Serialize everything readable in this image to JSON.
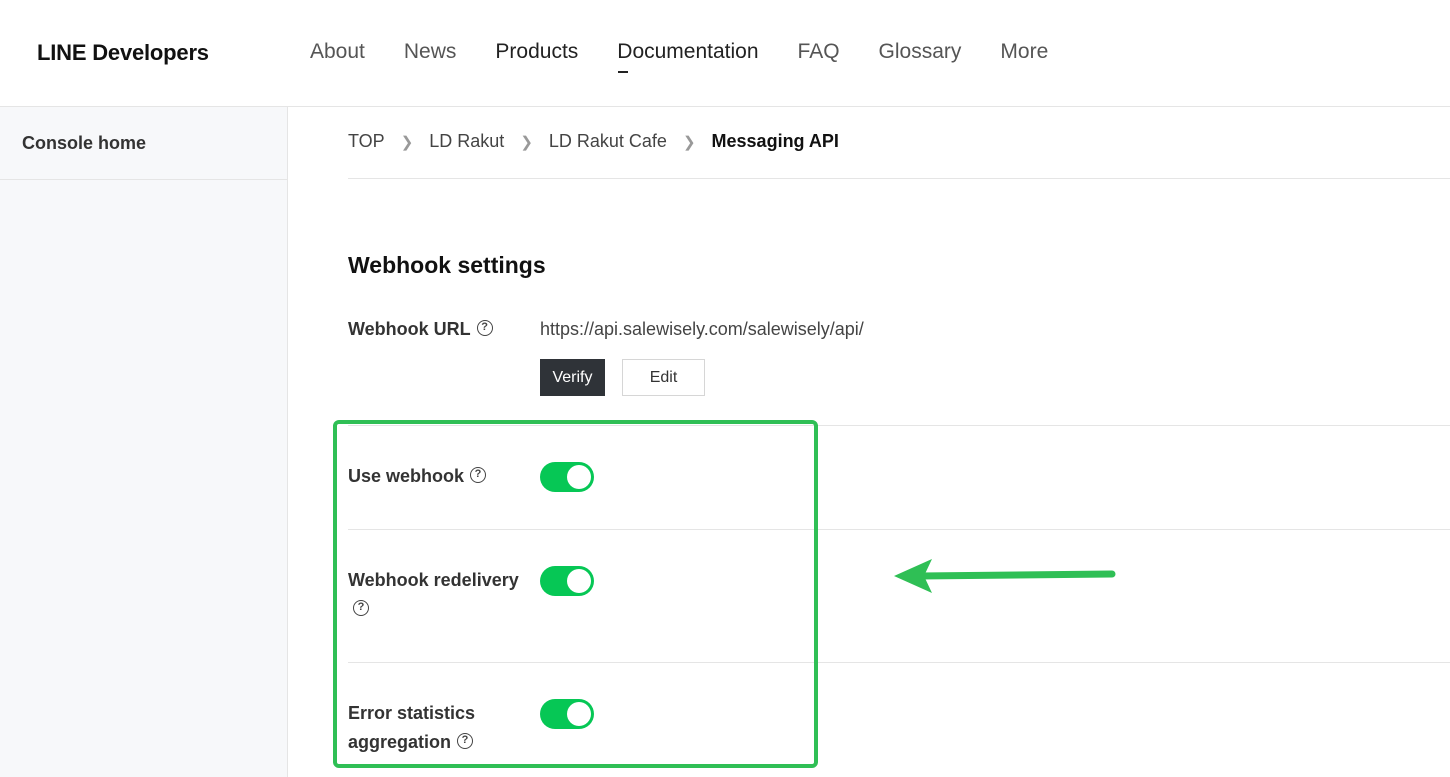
{
  "header": {
    "logo": "LINE Developers",
    "nav": [
      "About",
      "News",
      "Products",
      "Documentation",
      "FAQ",
      "Glossary",
      "More"
    ]
  },
  "sidebar": {
    "items": [
      {
        "label": "Console home"
      }
    ]
  },
  "breadcrumb": [
    "TOP",
    "LD Rakut",
    "LD Rakut Cafe",
    "Messaging API"
  ],
  "webhook": {
    "title": "Webhook settings",
    "url_label": "Webhook URL",
    "url_value": "https://api.salewisely.com/salewisely/api/",
    "url_suffix": ".",
    "verify_label": "Verify",
    "edit_label": "Edit",
    "use_webhook_label": "Use webhook",
    "redelivery_label": "Webhook redelivery",
    "error_stats_label_1": "Error statistics",
    "error_stats_label_2": "aggregation"
  },
  "toggles": {
    "use_webhook": true,
    "redelivery": true,
    "error_stats": true
  },
  "colors": {
    "toggle_on": "#06c755",
    "highlight": "#2fbf55",
    "verify_bg": "#2f3338"
  }
}
